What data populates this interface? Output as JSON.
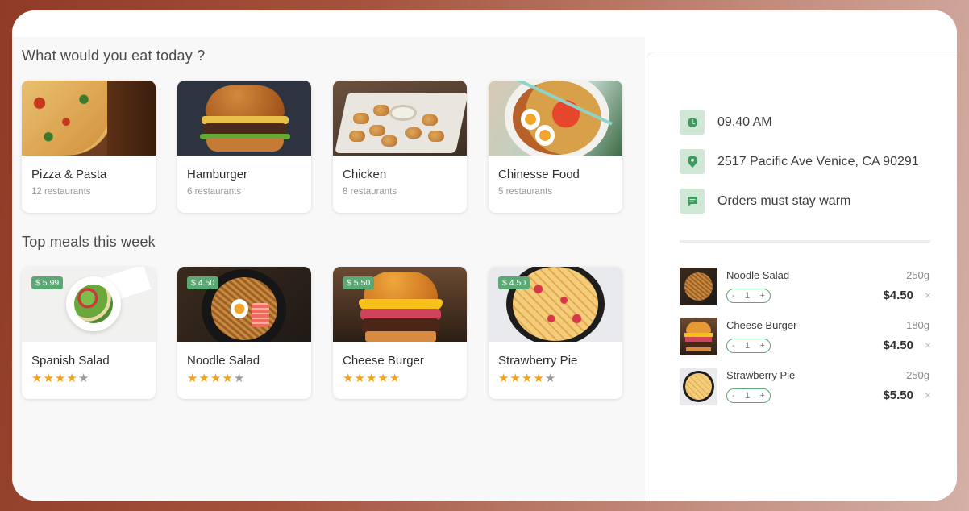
{
  "main": {
    "categories_title": "What would you eat today ?",
    "categories": [
      {
        "name": "Pizza & Pasta",
        "count": "12 restaurants"
      },
      {
        "name": "Hamburger",
        "count": "6 restaurants"
      },
      {
        "name": "Chicken",
        "count": "8 restaurants"
      },
      {
        "name": "Chinesse Food",
        "count": "5 restaurants"
      }
    ],
    "meals_title": "Top meals this week",
    "meals": [
      {
        "name": "Spanish Salad",
        "price": "$ 5.99",
        "rating": 4
      },
      {
        "name": "Noodle Salad",
        "price": "$ 4.50",
        "rating": 4
      },
      {
        "name": "Cheese Burger",
        "price": "$ 5.50",
        "rating": 5
      },
      {
        "name": "Strawberry Pie",
        "price": "$ 4.50",
        "rating": 4
      }
    ]
  },
  "side": {
    "time": "09.40 AM",
    "address": "2517 Pacific Ave Venice, CA 90291",
    "note": "Orders must stay warm",
    "orders": [
      {
        "name": "Noodle Salad",
        "weight": "250g",
        "qty": "1",
        "price": "$4.50"
      },
      {
        "name": "Cheese Burger",
        "weight": "180g",
        "qty": "1",
        "price": "$4.50"
      },
      {
        "name": "Strawberry Pie",
        "weight": "250g",
        "qty": "1",
        "price": "$5.50"
      }
    ],
    "minus": "-",
    "plus": "+",
    "remove": "×"
  },
  "colors": {
    "accent": "#5aa873",
    "star": "#f2a31b",
    "icon_bg": "#cfe8d6"
  },
  "icons": {
    "time": "clock-icon",
    "address": "location-pin-icon",
    "note": "chat-icon",
    "star": "star-icon",
    "remove": "close-icon"
  }
}
